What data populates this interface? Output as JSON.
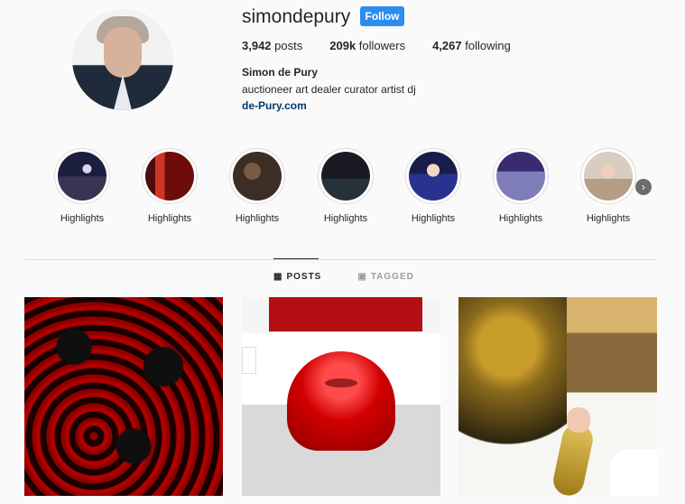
{
  "profile": {
    "username": "simondepury",
    "follow_label": "Follow",
    "stats": {
      "posts_value": "3,942",
      "posts_label": "posts",
      "followers_value": "209k",
      "followers_label": "followers",
      "following_value": "4,267",
      "following_label": "following"
    },
    "name": "Simon de Pury",
    "bio": "auctioneer art dealer curator artist dj",
    "link": "de-Pury.com"
  },
  "highlights": {
    "items": [
      {
        "label": "Highlights"
      },
      {
        "label": "Highlights"
      },
      {
        "label": "Highlights"
      },
      {
        "label": "Highlights"
      },
      {
        "label": "Highlights"
      },
      {
        "label": "Highlights"
      },
      {
        "label": "Highlights"
      }
    ],
    "next_icon": "chevron-right-icon"
  },
  "tabs": [
    {
      "label": "POSTS",
      "icon": "grid-icon"
    },
    {
      "label": "TAGGED",
      "icon": "tag-icon"
    }
  ],
  "colors": {
    "follow_button": "#2d8cf0",
    "link_text": "#00376b",
    "text_primary": "#262626"
  }
}
